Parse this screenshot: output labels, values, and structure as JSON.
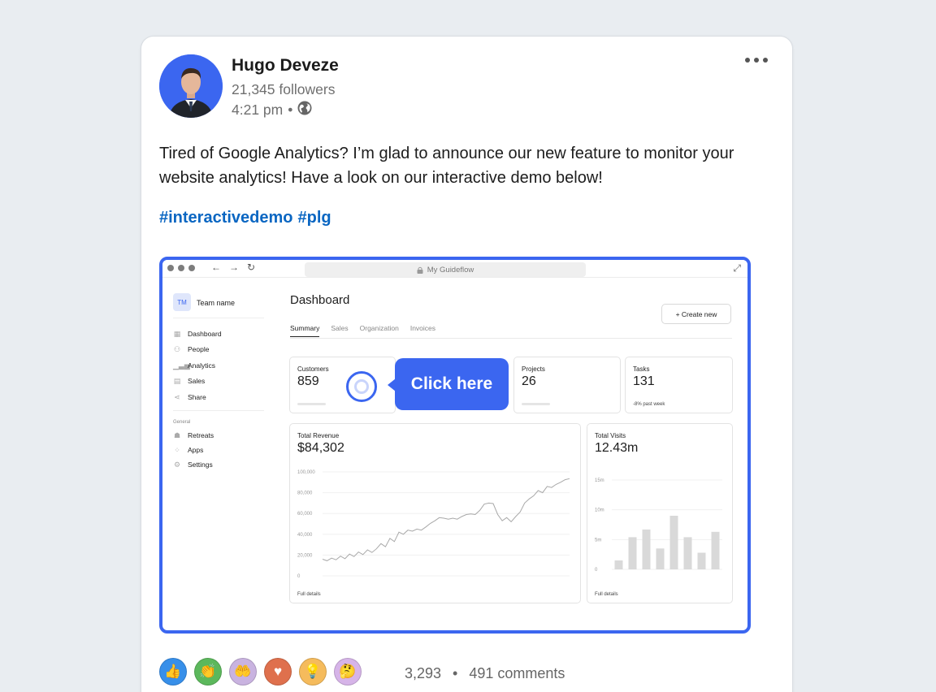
{
  "post": {
    "author": "Hugo Deveze",
    "followers": "21,345 followers",
    "time": "4:21 pm",
    "separator": "•",
    "text": "Tired of Google Analytics? I’m glad to announce our new feature to monitor your website analytics! Have a look on our interactive demo below!",
    "hashtags": [
      "#interactivedemo",
      "#plg"
    ]
  },
  "demo": {
    "browser": {
      "url": "My Guideflow"
    },
    "sidebar": {
      "team_badge": "TM",
      "team_name": "Team name",
      "items": [
        {
          "label": "Dashboard",
          "icon": "grid-icon"
        },
        {
          "label": "People",
          "icon": "people-icon"
        },
        {
          "label": "Analytics",
          "icon": "analytics-icon"
        },
        {
          "label": "Sales",
          "icon": "receipt-icon"
        },
        {
          "label": "Share",
          "icon": "share-icon"
        }
      ],
      "section": "General",
      "general_items": [
        {
          "label": "Retreats",
          "icon": "retreat-icon"
        },
        {
          "label": "Apps",
          "icon": "apps-icon"
        },
        {
          "label": "Settings",
          "icon": "gear-icon"
        }
      ]
    },
    "main": {
      "title": "Dashboard",
      "create_label": "+ Create new",
      "tabs": [
        "Summary",
        "Sales",
        "Organization",
        "Invoices"
      ],
      "active_tab": "Summary",
      "stats": [
        {
          "label": "Customers",
          "value": "859"
        },
        {
          "label": "Projects",
          "value": "26"
        },
        {
          "label": "Tasks",
          "value": "131",
          "sub": "-8% past week"
        }
      ],
      "tooltip": "Click here",
      "revenue": {
        "label": "Total Revenue",
        "value": "$84,302",
        "footer": "Full details"
      },
      "visits": {
        "label": "Total Visits",
        "value": "12.43m",
        "footer": "Full details"
      }
    }
  },
  "chart_data": [
    {
      "type": "line",
      "title": "Total Revenue",
      "y_ticks": [
        "100,000",
        "80,000",
        "60,000",
        "40,000",
        "20,000",
        "0"
      ],
      "ylim": [
        0,
        100000
      ],
      "values": [
        16000,
        14500,
        17000,
        15500,
        19000,
        16500,
        21000,
        18500,
        23000,
        20500,
        25000,
        22500,
        26000,
        31000,
        28000,
        36000,
        33000,
        42000,
        40000,
        44000,
        43000,
        45000,
        44000,
        47000,
        50500,
        53000,
        56000,
        55500,
        54500,
        55500,
        54500,
        57000,
        59000,
        59500,
        59000,
        63000,
        69000,
        70000,
        69500,
        59000,
        53000,
        56000,
        52000,
        57000,
        61500,
        70000,
        74000,
        77000,
        82000,
        80000,
        86000,
        85000,
        88000,
        90000,
        92500,
        93500
      ]
    },
    {
      "type": "bar",
      "title": "Total Visits",
      "y_ticks": [
        "15m",
        "10m",
        "5m",
        "0"
      ],
      "ylim": [
        0,
        15
      ],
      "values": [
        1.5,
        5.4,
        6.7,
        3.5,
        9,
        5.4,
        2.8,
        6.3
      ]
    }
  ],
  "footer": {
    "reactions": [
      "like-icon",
      "celebrate-icon",
      "support-icon",
      "love-icon",
      "insightful-icon",
      "curious-icon"
    ],
    "reaction_count": "3,293",
    "separator": "•",
    "comments": "491 comments"
  }
}
